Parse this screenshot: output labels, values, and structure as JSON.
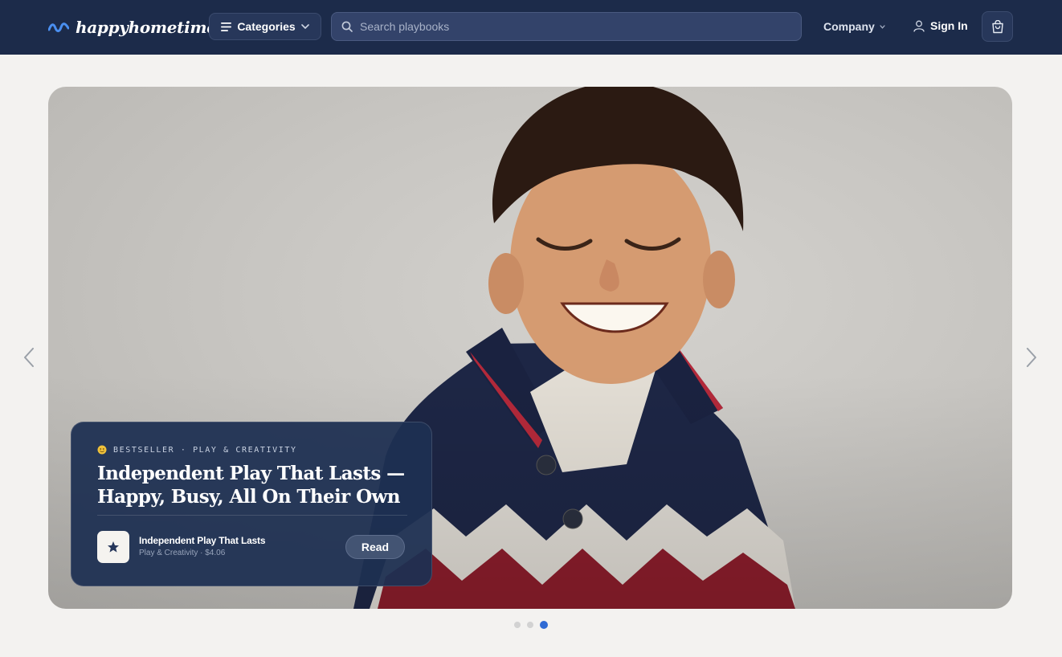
{
  "brand": {
    "name": "happyhometime",
    "accent": "#3d7be0"
  },
  "header": {
    "categories_label": "Categories",
    "search_placeholder": "Search playbooks",
    "search_value": "",
    "company_label": "Company",
    "signin_label": "Sign In"
  },
  "hero": {
    "eyebrow": "BESTSELLER · PLAY & CREATIVITY",
    "eyebrow_icon": "emoji-face-icon",
    "title_line1": "Independent Play That Lasts —",
    "title_line2": "Happy, Busy, All On Their Own",
    "product": {
      "name": "Independent Play That Lasts",
      "meta": "Play & Creativity · $4.06",
      "icon": "star-icon"
    },
    "read_label": "Read",
    "image": "smiling boy in navy zigzag knit sweater"
  },
  "carousel": {
    "slide_count": 3,
    "active_index": 2
  },
  "colors": {
    "header_bg": "#1c2b4a",
    "card_bg": "#1e3052",
    "page_bg": "#f3f2f0",
    "dot_active": "#2f6bd4"
  }
}
